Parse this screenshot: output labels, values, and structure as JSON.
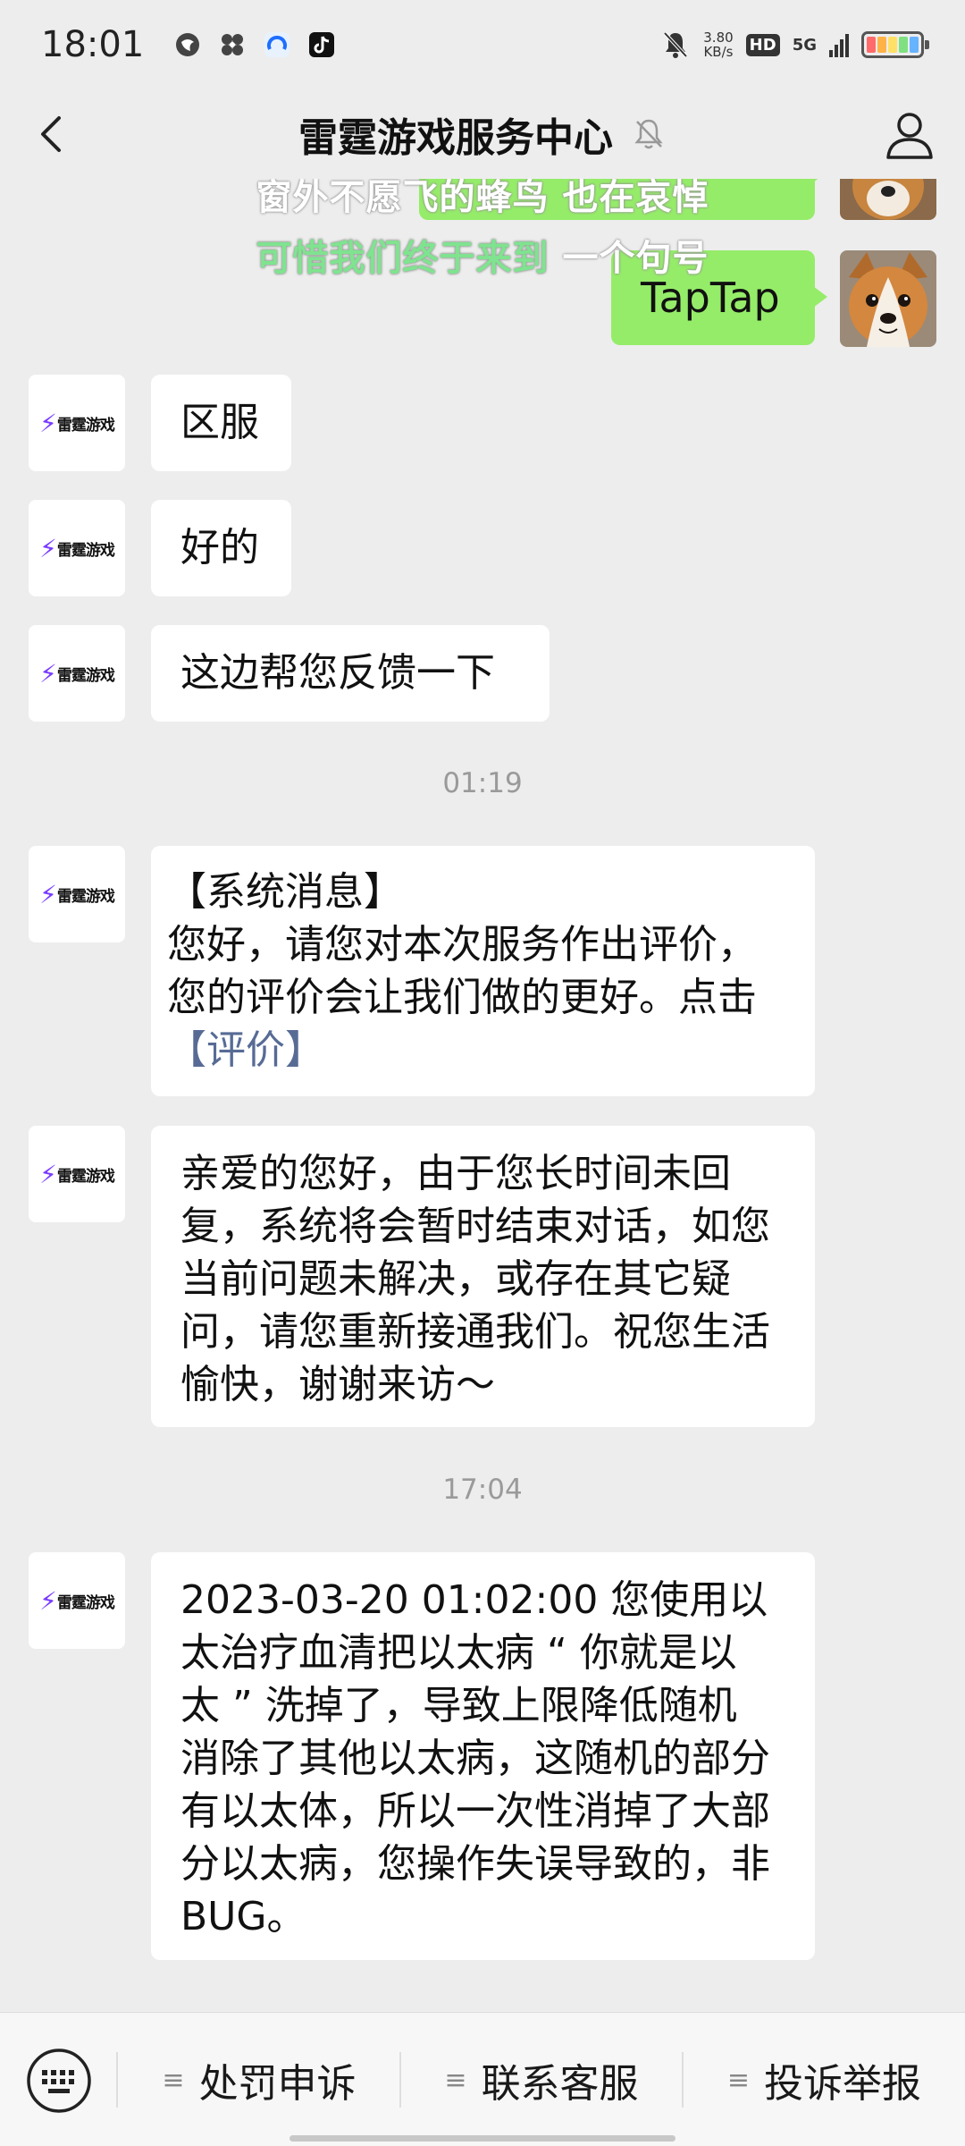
{
  "status_bar": {
    "time": "18:01",
    "net_speed_value": "3.80",
    "net_speed_unit": "KB/s",
    "hd": "HD",
    "signal": "5G"
  },
  "nav": {
    "title": "雷霆游戏服务中心"
  },
  "lyric": {
    "line1": "窗外不愿飞的蜂鸟 也在哀悼",
    "line2_highlight": "可惜我们终于来到",
    "line2_rest": " 一个句号"
  },
  "messages": {
    "m0": "TapTap",
    "m1": "区服",
    "m2": "好的",
    "m3": "这边帮您反馈一下",
    "ts1": "01:19",
    "m4_header": "【系统消息】",
    "m4_line1": "您好，请您对本次服务作出评价，",
    "m4_line2": "您的评价会让我们做的更好。点击",
    "m4_link": "【评价】",
    "m5_line1": "亲爱的您好，由于您长时间未回",
    "m5_line2": "复，系统将会暂时结束对话，如您",
    "m5_line3": "当前问题未解决，或存在其它疑",
    "m5_line4": "问，请您重新接通我们。祝您生活",
    "m5_line5": "愉快，谢谢来访～",
    "ts2": "17:04",
    "m6_line1": "2023-03-20 01:02:00 您使用以",
    "m6_line2": "太治疗血清把以太病 “ 你就是以",
    "m6_line3": "太 ” 洗掉了，导致上限降低随机",
    "m6_line4": "消除了其他以太病，这随机的部分",
    "m6_line5": "有以太体，所以一次性消掉了大部",
    "m6_line6": "分以太病，您操作失误导致的，非",
    "m6_line7": "BUG。"
  },
  "avatar_logo_text": "雷霆游戏",
  "bottom_menu": {
    "item1": "处罚申诉",
    "item2": "联系客服",
    "item3": "投诉举报"
  },
  "colors": {
    "background": "#ededed",
    "bubble_self": "#95ec69",
    "bubble_other": "#ffffff",
    "link": "#576b95",
    "timestamp": "#9a9a9a"
  },
  "icons": [
    "back-icon",
    "mute-bell-icon",
    "profile-icon",
    "keyboard-icon",
    "menu-lines-icon"
  ]
}
